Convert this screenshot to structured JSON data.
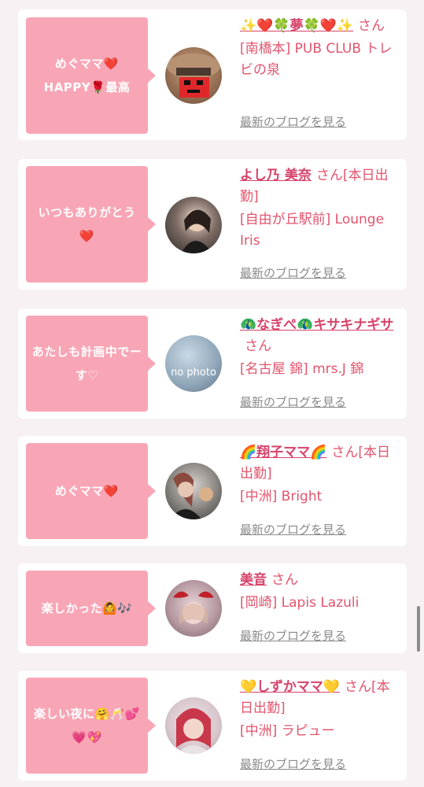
{
  "entries": [
    {
      "message": "めぐママ❤️ HAPPY🌹最高",
      "name": "✨❤️🍀夢🍀❤️✨",
      "suffix": "さん",
      "shop": "[南橋本] PUB CLUB トレビの泉",
      "blog_link": "最新のブログを見る",
      "avatar_kind": "hat-avatar"
    },
    {
      "message": "いつもありがとう❤️",
      "name": "よし乃 美奈",
      "suffix": "さん[本日出勤]",
      "shop": "[自由が丘駅前] Lounge Iris",
      "blog_link": "最新のブログを見る",
      "avatar_kind": "photo-avatar"
    },
    {
      "message": "あたしも計画中でーす♡",
      "name": "🦚なぎぺ🦚キサキナギサ",
      "suffix": "さん",
      "shop": "[名古屋 錦] mrs.J 錦",
      "blog_link": "最新のブログを見る",
      "avatar_kind": "no-photo-avatar",
      "avatar_text": "no photo"
    },
    {
      "message": "めぐママ❤️",
      "name": "🌈翔子ママ🌈",
      "suffix": "さん[本日出勤]",
      "shop": "[中洲] Bright",
      "blog_link": "最新のブログを見る",
      "avatar_kind": "photo-avatar"
    },
    {
      "message": "楽しかった🙆🎶",
      "name": "美音",
      "suffix": "さん",
      "shop": "[岡崎] Lapis Lazuli",
      "blog_link": "最新のブログを見る",
      "avatar_kind": "photo-avatar"
    },
    {
      "message": "楽しい夜に🤗🥂💕💗💖",
      "name": "💛しずかママ💛",
      "suffix": "さん[本日出勤]",
      "shop": "[中洲] ラピュー",
      "blog_link": "最新のブログを見る",
      "avatar_kind": "photo-avatar"
    }
  ],
  "colors": {
    "bubble": "#f8a6b6",
    "name": "#d6436a",
    "text": "#e2546d",
    "link": "#8a8a8a",
    "background": "#f7f1f3"
  }
}
